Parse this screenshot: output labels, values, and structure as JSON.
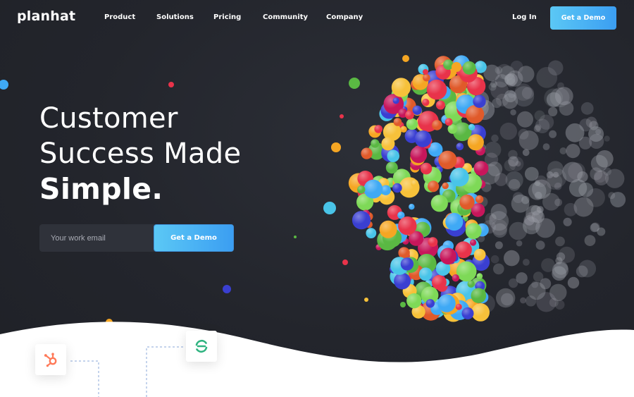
{
  "nav": {
    "logo": "planhat",
    "links": [
      "Product",
      "Solutions",
      "Pricing",
      "Community",
      "Company"
    ],
    "login": "Log In",
    "cta": "Get a Demo"
  },
  "hero": {
    "line1": "Customer",
    "line2": "Success Made",
    "line3": "Simple.",
    "email_placeholder": "Your work email",
    "cta": "Get a Demo"
  },
  "integrations": [
    "hubspot-icon",
    "sync-icon"
  ],
  "colors": {
    "background": "#23252c",
    "accent_start": "#5bc8f5",
    "accent_end": "#3b9ef2",
    "hubspot": "#ff7a59",
    "sync": "#2fb380",
    "bubbles": [
      "#e8334a",
      "#f5a623",
      "#5ab843",
      "#3fa9f5",
      "#3a3fd1",
      "#f7c13a",
      "#e05a2a",
      "#49c4e8",
      "#c7165b",
      "#7ed957"
    ]
  }
}
